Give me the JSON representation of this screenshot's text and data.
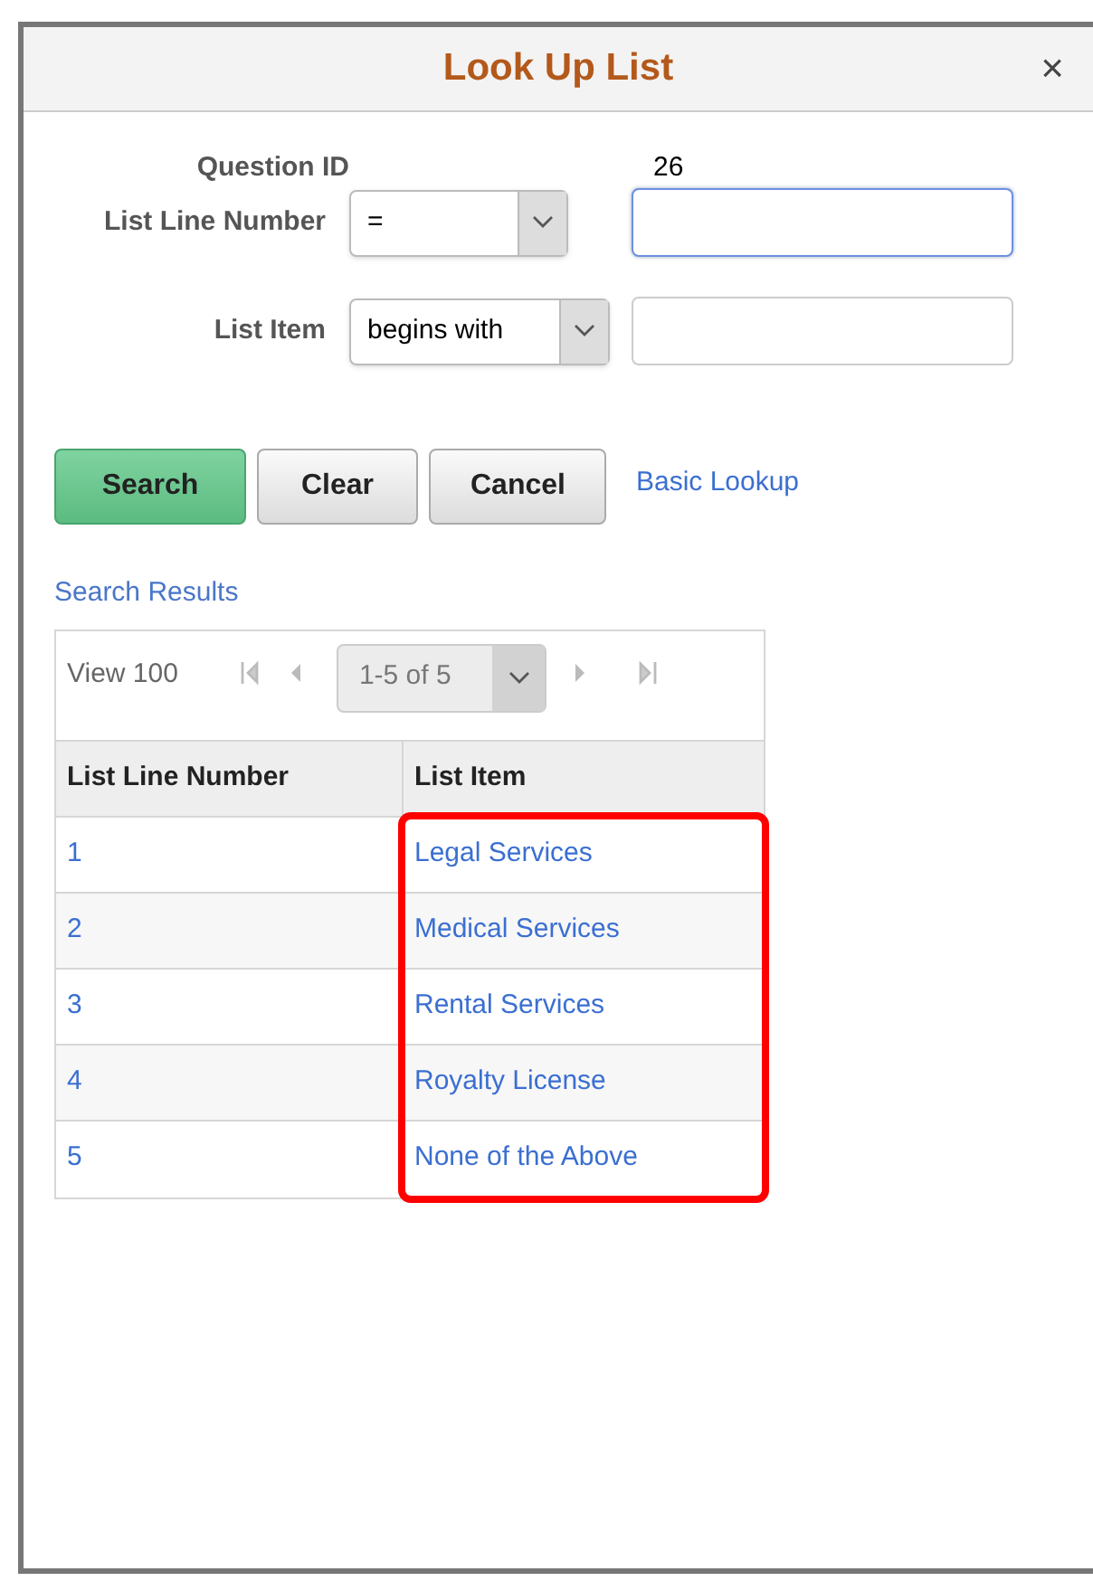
{
  "window": {
    "title": "Look Up List",
    "close": "×"
  },
  "fields": [
    {
      "kind": "readonly",
      "label": "Question ID",
      "value": "26"
    },
    {
      "kind": "criteria",
      "label": "List Line Number",
      "operator": "=",
      "focused": true
    },
    {
      "kind": "criteria",
      "label": "List Item",
      "operator": "begins with",
      "focused": false
    }
  ],
  "buttons": [
    {
      "label": "Search",
      "primary": true
    },
    {
      "label": "Clear",
      "primary": false
    },
    {
      "label": "Cancel",
      "primary": false
    }
  ],
  "basic_lookup_link": "Basic Lookup",
  "results": {
    "title": "Search Results",
    "view_all": "View 100",
    "page_range": "1-5 of 5",
    "columns": [
      {
        "label": "List Line Number",
        "highlighted": false
      },
      {
        "label": "List Item",
        "highlighted": true
      }
    ],
    "rows": [
      [
        "1",
        "Legal Services"
      ],
      [
        "2",
        "Medical Services"
      ],
      [
        "3",
        "Rental Services"
      ],
      [
        "4",
        "Royalty License"
      ],
      [
        "5",
        "None of the Above"
      ]
    ]
  }
}
